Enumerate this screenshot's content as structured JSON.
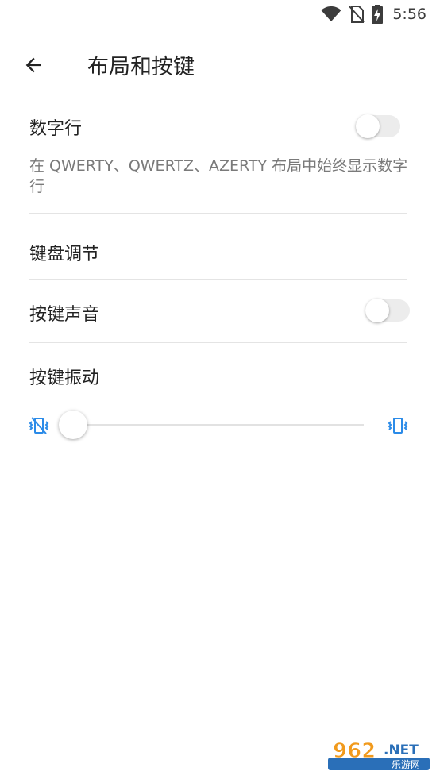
{
  "status_bar": {
    "time": "5:56",
    "icons": [
      "wifi-icon",
      "no-sim-icon",
      "battery-charging-icon"
    ]
  },
  "app_bar": {
    "back_icon": "arrow-back-icon",
    "title": "布局和按键"
  },
  "settings": {
    "number_row": {
      "title": "数字行",
      "summary": "在 QWERTY、QWERTZ、AZERTY 布局中始终显示数字行",
      "enabled": false
    },
    "keyboard_adjust": {
      "title": "键盘调节"
    },
    "key_sound": {
      "title": "按键声音",
      "enabled": false
    },
    "key_vibration": {
      "title": "按键振动",
      "level": 0,
      "min_icon": "vibration-off-icon",
      "max_icon": "vibration-on-icon"
    }
  },
  "colors": {
    "accent": "#2b8be8",
    "text_primary": "#222222",
    "text_secondary": "#7a7a7a",
    "divider": "#e4e4e4"
  },
  "watermark": {
    "number": "962",
    "suffix": ".NET",
    "subtitle": "乐游网"
  }
}
